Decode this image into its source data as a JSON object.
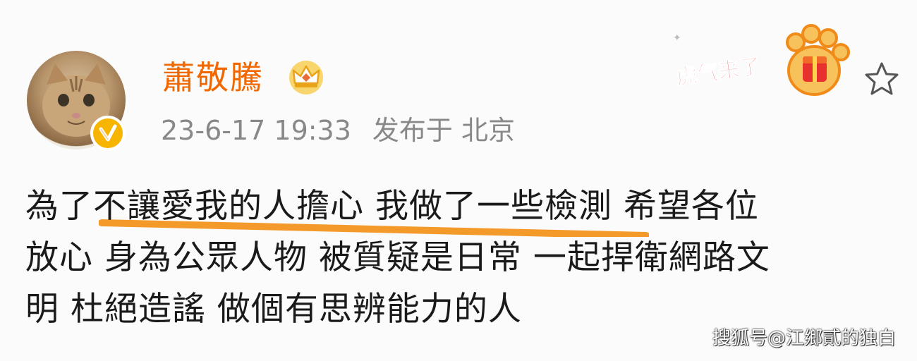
{
  "post": {
    "username": "蕭敬騰",
    "timestamp": "23-6-17 19:33",
    "location": "发布于 北京",
    "content_lines": [
      "為了不讓愛我的人擔心 我做了一些檢測 希望各位",
      "放心 身為公眾人物 被質疑是日常 一起捍衛網路文",
      "明 杜絕造謠 做個有思辨能力的人"
    ]
  },
  "promo": {
    "text": "虎气来了"
  },
  "watermark": {
    "text": "搜狐号@江鄉貳的独白"
  },
  "icons": {
    "avatar": "cat-avatar",
    "verified": "verified-v-icon",
    "member": "crown-icon",
    "favorite": "star-outline-icon",
    "promo": "tiger-paw-icon"
  },
  "colors": {
    "username": "#f16700",
    "meta": "#888888",
    "text": "#1a1a1a",
    "highlight_underline": "#f39a2a",
    "verified": "#f7b400",
    "promo": "#e8312f"
  }
}
